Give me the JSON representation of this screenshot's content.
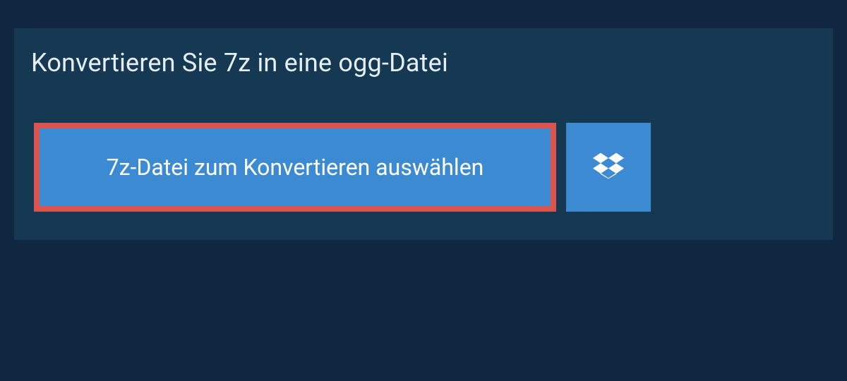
{
  "page": {
    "title": "Konvertieren Sie 7z in eine ogg-Datei"
  },
  "actions": {
    "select_file_label": "7z-Datei zum Konvertieren auswählen",
    "dropbox_icon": "dropbox"
  },
  "colors": {
    "bg": "#0f2740",
    "card": "#163953",
    "accent": "#3c8ad2",
    "highlight_border": "#d9544f",
    "text": "#e6eef5"
  }
}
